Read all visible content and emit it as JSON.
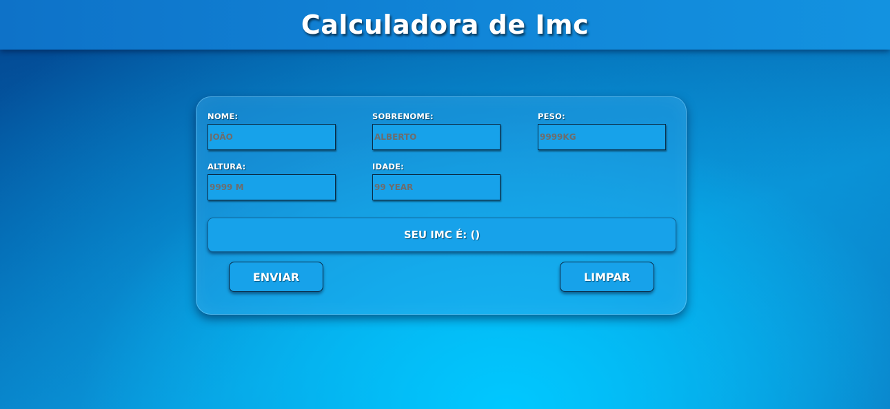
{
  "header": {
    "title": "Calculadora de Imc"
  },
  "form": {
    "fields": [
      {
        "label": "NOME:",
        "placeholder": "JOÃO"
      },
      {
        "label": "SOBRENOME:",
        "placeholder": "ALBERTO"
      },
      {
        "label": "PESO:",
        "placeholder": "9999KG"
      },
      {
        "label": "ALTURA:",
        "placeholder": "9999 M"
      },
      {
        "label": "IDADE:",
        "placeholder": "99 YEAR"
      }
    ],
    "result_text": "SEU IMC É: ()",
    "submit_label": "ENVIAR",
    "clear_label": "LIMPAR"
  },
  "colors": {
    "header_bg": "#1186d8",
    "input_bg": "#17a2ea",
    "text": "#ffffff"
  }
}
